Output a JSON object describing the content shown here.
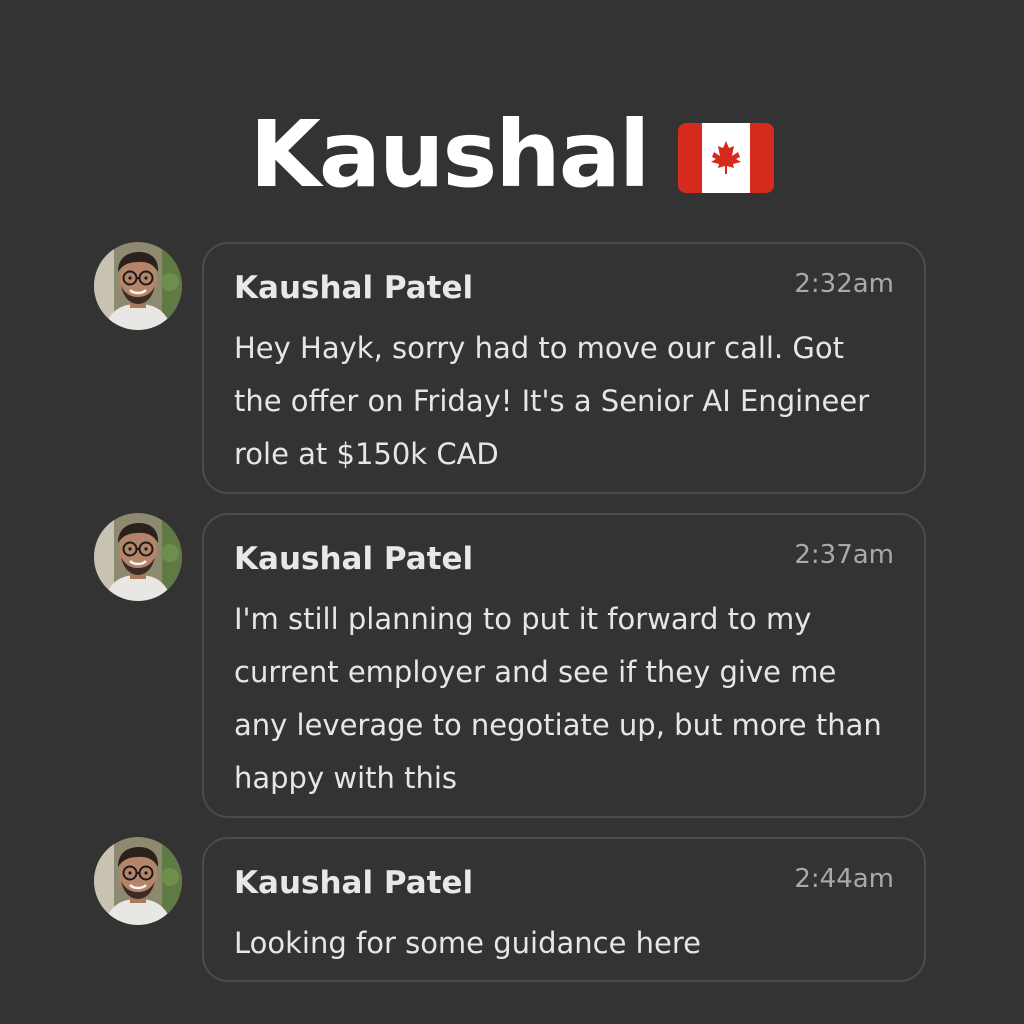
{
  "header": {
    "title": "Kaushal",
    "flag_icon": "canada-flag-icon"
  },
  "colors": {
    "background": "#333333",
    "bubble_border": "#4b4b4b",
    "flag_red": "#d52b1e"
  },
  "messages": [
    {
      "sender": "Kaushal Patel",
      "time": "2:32am",
      "text": "Hey Hayk, sorry had to move our call. Got the offer on Friday! It's a Senior AI Engineer role at $150k CAD"
    },
    {
      "sender": "Kaushal Patel",
      "time": "2:37am",
      "text": "I'm still planning to put it forward to my current employer and see if they give me any leverage to negotiate up, but more than happy with this"
    },
    {
      "sender": "Kaushal Patel",
      "time": "2:44am",
      "text": "Looking for some guidance here"
    }
  ]
}
